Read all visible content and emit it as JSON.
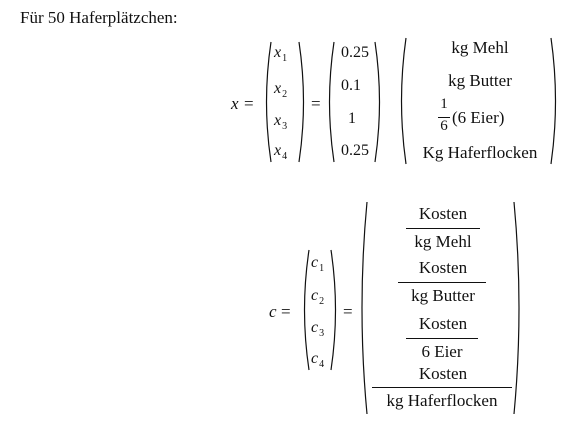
{
  "heading": "Für 50 Haferplätzchen:",
  "x_equation": {
    "lhs": "x",
    "equals": "=",
    "vector": [
      {
        "base": "x",
        "sub": "1"
      },
      {
        "base": "x",
        "sub": "2"
      },
      {
        "base": "x",
        "sub": "3"
      },
      {
        "base": "x",
        "sub": "4"
      }
    ],
    "values": [
      "0.25",
      "0.1",
      "1",
      "0.25"
    ],
    "units": {
      "u1": "kg Mehl",
      "u2": "kg Butter",
      "u3_num": "1",
      "u3_den": "6",
      "u3_text": "(6 Eier)",
      "u4": "Kg Haferflocken"
    }
  },
  "c_equation": {
    "lhs": "c",
    "equals": "=",
    "vector": [
      {
        "base": "c",
        "sub": "1"
      },
      {
        "base": "c",
        "sub": "2"
      },
      {
        "base": "c",
        "sub": "3"
      },
      {
        "base": "c",
        "sub": "4"
      }
    ],
    "fractions": [
      {
        "num": "Kosten",
        "den": "kg Mehl"
      },
      {
        "num": "Kosten",
        "den": "kg Butter"
      },
      {
        "num": "Kosten",
        "den": "6 Eier"
      },
      {
        "num": "Kosten",
        "den": "kg Haferflocken"
      }
    ]
  }
}
